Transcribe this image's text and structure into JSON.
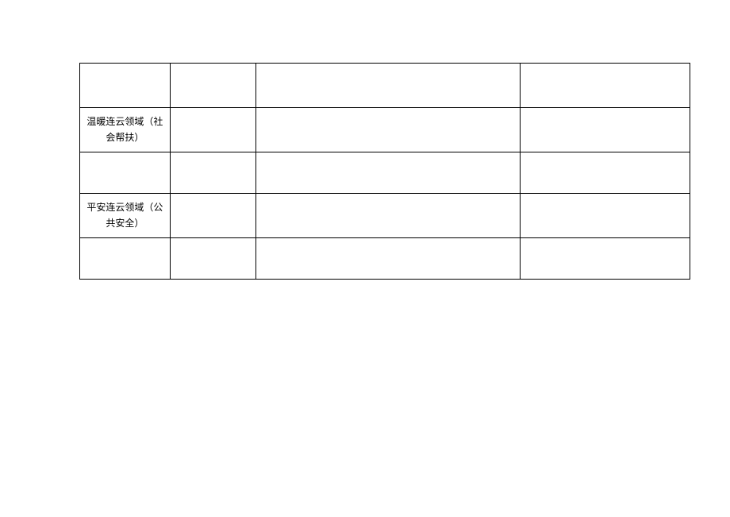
{
  "table": {
    "rows": [
      {
        "col1": "",
        "col2": "",
        "col3": "",
        "col4": ""
      },
      {
        "col1": "温暖连云领域（社会帮扶）",
        "col2": "",
        "col3": "",
        "col4": ""
      },
      {
        "col1": "",
        "col2": "",
        "col3": "",
        "col4": ""
      },
      {
        "col1": "平安连云领域（公共安全）",
        "col2": "",
        "col3": "",
        "col4": ""
      },
      {
        "col1": "",
        "col2": "",
        "col3": "",
        "col4": ""
      }
    ]
  }
}
